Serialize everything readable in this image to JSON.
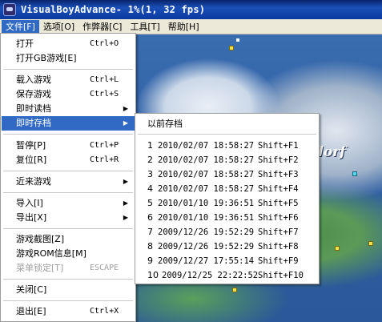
{
  "window": {
    "title": "VisualBoyAdvance-  1%(1, 32 fps)"
  },
  "menubar": {
    "items": [
      {
        "label": "文件[F]"
      },
      {
        "label": "选项[O]"
      },
      {
        "label": "作弊器[C]"
      },
      {
        "label": "工具[T]"
      },
      {
        "label": "帮助[H]"
      }
    ]
  },
  "game": {
    "overlay_text": "dorf"
  },
  "file_menu": {
    "items": [
      {
        "label": "打开",
        "accel": "Ctrl+O"
      },
      {
        "label": "打开GB游戏[E]",
        "accel": ""
      },
      {
        "label": "载入游戏",
        "accel": "Ctrl+L"
      },
      {
        "label": "保存游戏",
        "accel": "Ctrl+S"
      },
      {
        "label": "即时读档",
        "accel": ""
      },
      {
        "label": "即时存档",
        "accel": ""
      },
      {
        "label": "暂停[P]",
        "accel": "Ctrl+P"
      },
      {
        "label": "复位[R]",
        "accel": "Ctrl+R"
      },
      {
        "label": "近来游戏",
        "accel": ""
      },
      {
        "label": "导入[I]",
        "accel": ""
      },
      {
        "label": "导出[X]",
        "accel": ""
      },
      {
        "label": "游戏截图[Z]",
        "accel": ""
      },
      {
        "label": "游戏ROM信息[M]",
        "accel": ""
      },
      {
        "label": "菜单锁定[T]",
        "accel": "ESCAPE"
      },
      {
        "label": "关闭[C]",
        "accel": ""
      },
      {
        "label": "退出[E]",
        "accel": "Ctrl+X"
      }
    ]
  },
  "save_submenu": {
    "header": "以前存档",
    "slots": [
      {
        "num": "1",
        "when": "2010/02/07 18:58:27",
        "accel": "Shift+F1"
      },
      {
        "num": "2",
        "when": "2010/02/07 18:58:27",
        "accel": "Shift+F2"
      },
      {
        "num": "3",
        "when": "2010/02/07 18:58:27",
        "accel": "Shift+F3"
      },
      {
        "num": "4",
        "when": "2010/02/07 18:58:27",
        "accel": "Shift+F4"
      },
      {
        "num": "5",
        "when": "2010/01/10 19:36:51",
        "accel": "Shift+F5"
      },
      {
        "num": "6",
        "when": "2010/01/10 19:36:51",
        "accel": "Shift+F6"
      },
      {
        "num": "7",
        "when": "2009/12/26 19:52:29",
        "accel": "Shift+F7"
      },
      {
        "num": "8",
        "when": "2009/12/26 19:52:29",
        "accel": "Shift+F8"
      },
      {
        "num": "9",
        "when": "2009/12/27 17:55:14",
        "accel": "Shift+F9"
      },
      {
        "num": "10",
        "when": "2009/12/25 22:22:52",
        "accel": "Shift+F10"
      }
    ]
  },
  "colors": {
    "selection": "#316ac5",
    "titlebar": "#0a246a",
    "menubar": "#ece9d8"
  }
}
